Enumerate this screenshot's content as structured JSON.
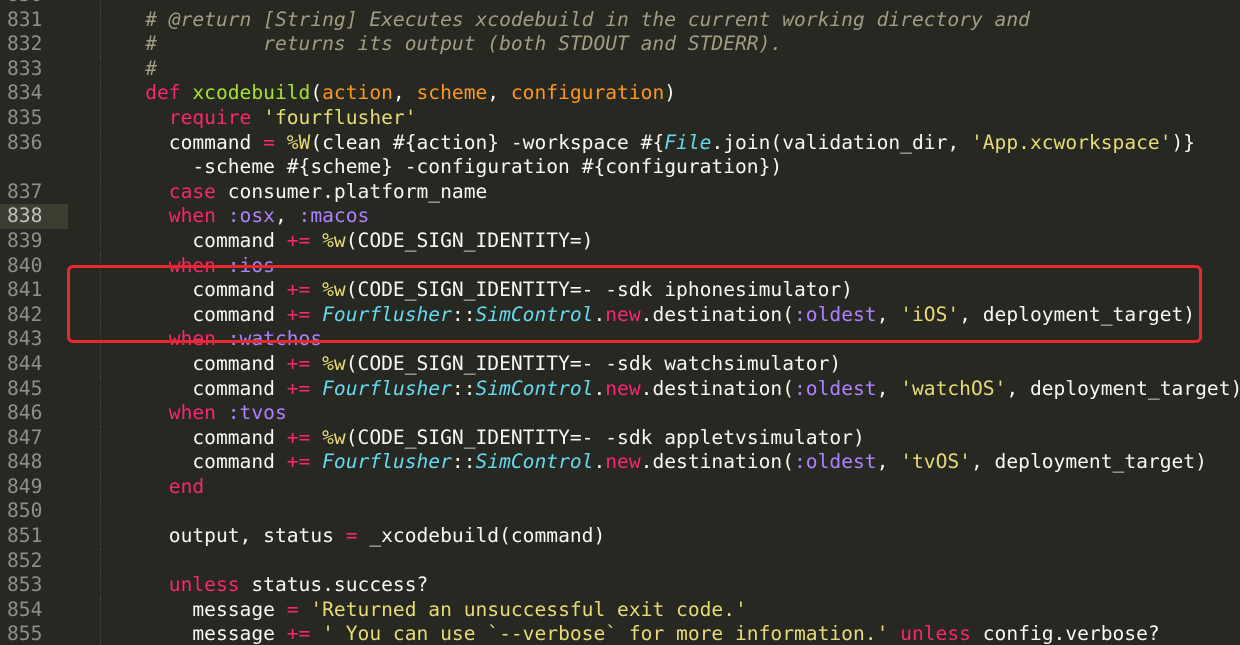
{
  "editor": {
    "theme_colors": {
      "background": "#272822",
      "line_number": "#8f908a",
      "current_line_gutter": "#3e3d32",
      "highlight_box": "#e8282a",
      "keyword": "#f92672",
      "function": "#a6e22e",
      "parameter": "#fd971f",
      "string": "#e6db74",
      "symbol": "#ae81ff",
      "constant": "#66d9ef",
      "comment": "#a19c82",
      "text": "#f8f8f2"
    },
    "current_line": "838",
    "highlighted_lines": [
      "840",
      "841",
      "842"
    ],
    "lines": [
      {
        "num": "830",
        "tokens": []
      },
      {
        "num": "831",
        "tokens": [
          {
            "t": "    ",
            "c": "plain"
          },
          {
            "t": "# @return [String] Executes xcodebuild in the current working directory and",
            "c": "comment"
          }
        ]
      },
      {
        "num": "832",
        "tokens": [
          {
            "t": "    ",
            "c": "plain"
          },
          {
            "t": "#         returns its output (both STDOUT and STDERR).",
            "c": "comment"
          }
        ]
      },
      {
        "num": "833",
        "tokens": [
          {
            "t": "    ",
            "c": "plain"
          },
          {
            "t": "#",
            "c": "comment"
          }
        ]
      },
      {
        "num": "834",
        "tokens": [
          {
            "t": "    ",
            "c": "plain"
          },
          {
            "t": "def",
            "c": "keyword"
          },
          {
            "t": " ",
            "c": "plain"
          },
          {
            "t": "xcodebuild",
            "c": "fn"
          },
          {
            "t": "(",
            "c": "plain"
          },
          {
            "t": "action",
            "c": "param"
          },
          {
            "t": ", ",
            "c": "plain"
          },
          {
            "t": "scheme",
            "c": "param"
          },
          {
            "t": ", ",
            "c": "plain"
          },
          {
            "t": "configuration",
            "c": "param"
          },
          {
            "t": ")",
            "c": "plain"
          }
        ]
      },
      {
        "num": "835",
        "tokens": [
          {
            "t": "      ",
            "c": "plain"
          },
          {
            "t": "require",
            "c": "keyword"
          },
          {
            "t": " ",
            "c": "plain"
          },
          {
            "t": "'fourflusher'",
            "c": "string"
          }
        ]
      },
      {
        "num": "836",
        "tokens": [
          {
            "t": "      command ",
            "c": "plain"
          },
          {
            "t": "=",
            "c": "op"
          },
          {
            "t": " ",
            "c": "plain"
          },
          {
            "t": "%W",
            "c": "string"
          },
          {
            "t": "(clean #{action} -workspace #{",
            "c": "plain"
          },
          {
            "t": "File",
            "c": "const"
          },
          {
            "t": ".join(validation_dir, ",
            "c": "plain"
          },
          {
            "t": "'App.xcworkspace'",
            "c": "string"
          },
          {
            "t": ")}",
            "c": "plain"
          }
        ]
      },
      {
        "num": "",
        "tokens": [
          {
            "t": "        -scheme #{scheme} -configuration #{configuration})",
            "c": "plain"
          }
        ]
      },
      {
        "num": "837",
        "tokens": [
          {
            "t": "      ",
            "c": "plain"
          },
          {
            "t": "case",
            "c": "keyword"
          },
          {
            "t": " consumer.platform_name",
            "c": "plain"
          }
        ]
      },
      {
        "num": "838",
        "tokens": [
          {
            "t": "      ",
            "c": "plain"
          },
          {
            "t": "when",
            "c": "keyword"
          },
          {
            "t": " ",
            "c": "plain"
          },
          {
            "t": ":osx",
            "c": "symbol"
          },
          {
            "t": ", ",
            "c": "plain"
          },
          {
            "t": ":macos",
            "c": "symbol"
          }
        ]
      },
      {
        "num": "839",
        "tokens": [
          {
            "t": "        command ",
            "c": "plain"
          },
          {
            "t": "+=",
            "c": "op"
          },
          {
            "t": " ",
            "c": "plain"
          },
          {
            "t": "%w",
            "c": "string"
          },
          {
            "t": "(CODE_SIGN_IDENTITY=)",
            "c": "plain"
          }
        ]
      },
      {
        "num": "840",
        "tokens": [
          {
            "t": "      ",
            "c": "plain"
          },
          {
            "t": "when",
            "c": "keyword"
          },
          {
            "t": " ",
            "c": "plain"
          },
          {
            "t": ":ios",
            "c": "symbol"
          }
        ]
      },
      {
        "num": "841",
        "tokens": [
          {
            "t": "        command ",
            "c": "plain"
          },
          {
            "t": "+=",
            "c": "op"
          },
          {
            "t": " ",
            "c": "plain"
          },
          {
            "t": "%w",
            "c": "string"
          },
          {
            "t": "(CODE_SIGN_IDENTITY=- -sdk iphonesimulator)",
            "c": "plain"
          }
        ]
      },
      {
        "num": "842",
        "tokens": [
          {
            "t": "        command ",
            "c": "plain"
          },
          {
            "t": "+=",
            "c": "op"
          },
          {
            "t": " ",
            "c": "plain"
          },
          {
            "t": "Fourflusher",
            "c": "const"
          },
          {
            "t": "::",
            "c": "plain"
          },
          {
            "t": "SimControl",
            "c": "const"
          },
          {
            "t": ".",
            "c": "plain"
          },
          {
            "t": "new",
            "c": "keyword"
          },
          {
            "t": ".destination(",
            "c": "plain"
          },
          {
            "t": ":oldest",
            "c": "symbol"
          },
          {
            "t": ", ",
            "c": "plain"
          },
          {
            "t": "'iOS'",
            "c": "string"
          },
          {
            "t": ", deployment_target)",
            "c": "plain"
          }
        ]
      },
      {
        "num": "843",
        "tokens": [
          {
            "t": "      ",
            "c": "plain"
          },
          {
            "t": "when",
            "c": "keyword"
          },
          {
            "t": " ",
            "c": "plain"
          },
          {
            "t": ":watchos",
            "c": "symbol"
          }
        ]
      },
      {
        "num": "844",
        "tokens": [
          {
            "t": "        command ",
            "c": "plain"
          },
          {
            "t": "+=",
            "c": "op"
          },
          {
            "t": " ",
            "c": "plain"
          },
          {
            "t": "%w",
            "c": "string"
          },
          {
            "t": "(CODE_SIGN_IDENTITY=- -sdk watchsimulator)",
            "c": "plain"
          }
        ]
      },
      {
        "num": "845",
        "tokens": [
          {
            "t": "        command ",
            "c": "plain"
          },
          {
            "t": "+=",
            "c": "op"
          },
          {
            "t": " ",
            "c": "plain"
          },
          {
            "t": "Fourflusher",
            "c": "const"
          },
          {
            "t": "::",
            "c": "plain"
          },
          {
            "t": "SimControl",
            "c": "const"
          },
          {
            "t": ".",
            "c": "plain"
          },
          {
            "t": "new",
            "c": "keyword"
          },
          {
            "t": ".destination(",
            "c": "plain"
          },
          {
            "t": ":oldest",
            "c": "symbol"
          },
          {
            "t": ", ",
            "c": "plain"
          },
          {
            "t": "'watchOS'",
            "c": "string"
          },
          {
            "t": ", deployment_target)",
            "c": "plain"
          }
        ]
      },
      {
        "num": "846",
        "tokens": [
          {
            "t": "      ",
            "c": "plain"
          },
          {
            "t": "when",
            "c": "keyword"
          },
          {
            "t": " ",
            "c": "plain"
          },
          {
            "t": ":tvos",
            "c": "symbol"
          }
        ]
      },
      {
        "num": "847",
        "tokens": [
          {
            "t": "        command ",
            "c": "plain"
          },
          {
            "t": "+=",
            "c": "op"
          },
          {
            "t": " ",
            "c": "plain"
          },
          {
            "t": "%w",
            "c": "string"
          },
          {
            "t": "(CODE_SIGN_IDENTITY=- -sdk appletvsimulator)",
            "c": "plain"
          }
        ]
      },
      {
        "num": "848",
        "tokens": [
          {
            "t": "        command ",
            "c": "plain"
          },
          {
            "t": "+=",
            "c": "op"
          },
          {
            "t": " ",
            "c": "plain"
          },
          {
            "t": "Fourflusher",
            "c": "const"
          },
          {
            "t": "::",
            "c": "plain"
          },
          {
            "t": "SimControl",
            "c": "const"
          },
          {
            "t": ".",
            "c": "plain"
          },
          {
            "t": "new",
            "c": "keyword"
          },
          {
            "t": ".destination(",
            "c": "plain"
          },
          {
            "t": ":oldest",
            "c": "symbol"
          },
          {
            "t": ", ",
            "c": "plain"
          },
          {
            "t": "'tvOS'",
            "c": "string"
          },
          {
            "t": ", deployment_target)",
            "c": "plain"
          }
        ]
      },
      {
        "num": "849",
        "tokens": [
          {
            "t": "      ",
            "c": "plain"
          },
          {
            "t": "end",
            "c": "keyword"
          }
        ]
      },
      {
        "num": "850",
        "tokens": []
      },
      {
        "num": "851",
        "tokens": [
          {
            "t": "      output, status ",
            "c": "plain"
          },
          {
            "t": "=",
            "c": "op"
          },
          {
            "t": " _xcodebuild(command)",
            "c": "plain"
          }
        ]
      },
      {
        "num": "852",
        "tokens": []
      },
      {
        "num": "853",
        "tokens": [
          {
            "t": "      ",
            "c": "plain"
          },
          {
            "t": "unless",
            "c": "keyword"
          },
          {
            "t": " status.success?",
            "c": "plain"
          }
        ]
      },
      {
        "num": "854",
        "tokens": [
          {
            "t": "        message ",
            "c": "plain"
          },
          {
            "t": "=",
            "c": "op"
          },
          {
            "t": " ",
            "c": "plain"
          },
          {
            "t": "'Returned an unsuccessful exit code.'",
            "c": "string"
          }
        ]
      },
      {
        "num": "855",
        "tokens": [
          {
            "t": "        message ",
            "c": "plain"
          },
          {
            "t": "+=",
            "c": "op"
          },
          {
            "t": " ",
            "c": "plain"
          },
          {
            "t": "' You can use `--verbose` for more information.'",
            "c": "string"
          },
          {
            "t": " ",
            "c": "plain"
          },
          {
            "t": "unless",
            "c": "keyword"
          },
          {
            "t": " config.verbose?",
            "c": "plain"
          }
        ]
      }
    ]
  }
}
